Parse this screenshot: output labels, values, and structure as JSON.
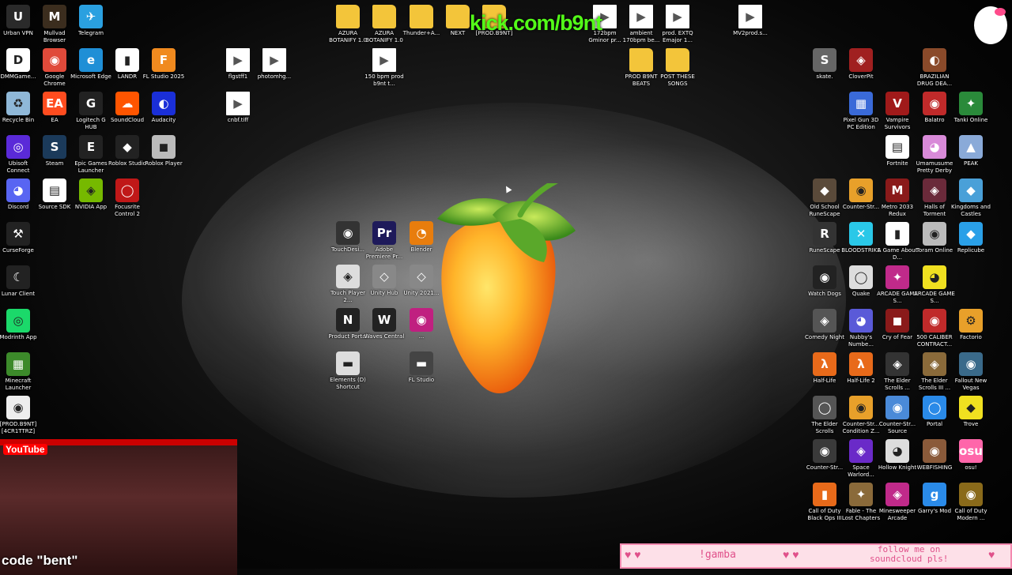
{
  "overlay": {
    "kick": "kick.com/b9nt",
    "code": "code \"bent\"",
    "gamba": "!gamba",
    "follow_line1": "follow me on",
    "follow_line2": "soundcloud pls!",
    "youtube": "YouTube"
  },
  "desktop": {
    "icons_left": [
      {
        "name": "ucloud-vpn-icon",
        "label": "Urban VPN",
        "glyph": "U",
        "color": "#2a2a2a"
      },
      {
        "name": "mullvad-browser-icon",
        "label": "Mullvad Browser",
        "glyph": "M",
        "color": "#3b2d1e"
      },
      {
        "name": "telegram-icon",
        "label": "Telegram",
        "glyph": "✈",
        "color": "#2aa0e0"
      },
      {
        "name": "dmm-icon",
        "label": "DMMGame...",
        "glyph": "D",
        "color": "#fff"
      },
      {
        "name": "google-chrome-icon",
        "label": "Google Chrome",
        "glyph": "◉",
        "color": "#e04a3a"
      },
      {
        "name": "microsoft-edge-icon",
        "label": "Microsoft Edge",
        "glyph": "e",
        "color": "#1f8fd6"
      },
      {
        "name": "landr-icon",
        "label": "LANDR",
        "glyph": "▮",
        "color": "#fff"
      },
      {
        "name": "fl-studio-icon",
        "label": "FL Studio 2025",
        "glyph": "F",
        "color": "#f08a1f"
      },
      {
        "name": "recycle-bin-icon",
        "label": "Recycle Bin",
        "glyph": "♻",
        "color": "#8fb8d8"
      },
      {
        "name": "ea-icon",
        "label": "EA",
        "glyph": "EA",
        "color": "#ff4c1f"
      },
      {
        "name": "logitech-ghub-icon",
        "label": "Logitech G HUB",
        "glyph": "G",
        "color": "#222"
      },
      {
        "name": "soundcloud-icon",
        "label": "SoundCloud",
        "glyph": "☁",
        "color": "#ff5500"
      },
      {
        "name": "audacity-icon",
        "label": "Audacity",
        "glyph": "◐",
        "color": "#1a2fd8"
      },
      {
        "name": "ubisoft-connect-icon",
        "label": "Ubisoft Connect",
        "glyph": "◎",
        "color": "#5a2ad8"
      },
      {
        "name": "steam-icon",
        "label": "Steam",
        "glyph": "S",
        "color": "#1b3a5a"
      },
      {
        "name": "epic-games-icon",
        "label": "Epic Games Launcher",
        "glyph": "E",
        "color": "#222"
      },
      {
        "name": "roblox-studio-icon",
        "label": "Roblox Studio",
        "glyph": "◆",
        "color": "#222"
      },
      {
        "name": "roblox-player-icon",
        "label": "Roblox Player",
        "glyph": "◼",
        "color": "#bbb"
      },
      {
        "name": "discord-icon",
        "label": "Discord",
        "glyph": "◕",
        "color": "#5865f2"
      },
      {
        "name": "source-sdk-icon",
        "label": "Source SDK",
        "glyph": "▤",
        "color": "#fff"
      },
      {
        "name": "nvidia-app-icon",
        "label": "NVIDIA App",
        "glyph": "◈",
        "color": "#76b900"
      },
      {
        "name": "focusrite-icon",
        "label": "Focusrite Control 2",
        "glyph": "◯",
        "color": "#c01818"
      },
      {
        "name": "curseforge-icon",
        "label": "CurseForge",
        "glyph": "⚒",
        "color": "#222"
      },
      {
        "name": "lunar-client-icon",
        "label": "Lunar Client",
        "glyph": "☾",
        "color": "#222"
      },
      {
        "name": "modrinth-icon",
        "label": "Modrinth App",
        "glyph": "◎",
        "color": "#1bd96a"
      },
      {
        "name": "minecraft-launcher-icon",
        "label": "Minecraft Launcher",
        "glyph": "▦",
        "color": "#3c8a2a"
      },
      {
        "name": "prod-b9nt-icon",
        "label": "[PROD.B9NT] [4CR1TTRZ]",
        "glyph": "◉",
        "color": "#eee"
      }
    ],
    "icons_top": [
      {
        "name": "folder-azura-1-icon",
        "label": "AZURA BOTANIFY 1.0",
        "kind": "folder"
      },
      {
        "name": "folder-azura-2-icon",
        "label": "AZURA BOTANIFY 1.0",
        "kind": "folder"
      },
      {
        "name": "folder-thunder-icon",
        "label": "Thunder+A...",
        "kind": "folder"
      },
      {
        "name": "folder-next-icon",
        "label": "NEXT",
        "kind": "folder"
      },
      {
        "name": "folder-prod-icon",
        "label": "[PROD.B9NT]",
        "kind": "folder"
      },
      {
        "name": "audio-172bpm-icon",
        "label": "172bpm Gminor pr...",
        "kind": "doc"
      },
      {
        "name": "audio-ambient-icon",
        "label": "ambient 170bpm be...",
        "kind": "doc"
      },
      {
        "name": "audio-extq-icon",
        "label": "prod. EXTQ Emajor 1...",
        "kind": "doc"
      },
      {
        "name": "audio-mv2-icon",
        "label": "MV2prod.s...",
        "kind": "doc"
      },
      {
        "name": "file-flgstff-icon",
        "label": "flgstff1",
        "kind": "doc"
      },
      {
        "name": "file-photomhg-icon",
        "label": "photomhg...",
        "kind": "doc"
      },
      {
        "name": "audio-150bpm-icon",
        "label": "150 bpm prod b9nt t...",
        "kind": "doc"
      },
      {
        "name": "file-cnbf-icon",
        "label": "cnbf.tiff",
        "kind": "doc"
      },
      {
        "name": "folder-prod-beats-icon",
        "label": "PROD B9NT BEATS",
        "kind": "folder"
      },
      {
        "name": "folder-post-songs-icon",
        "label": "POST THESE SONGS",
        "kind": "folder"
      }
    ],
    "icons_center": [
      {
        "name": "touchdesigner-icon",
        "label": "TouchDesi...",
        "glyph": "◉",
        "color": "#333"
      },
      {
        "name": "adobe-premiere-icon",
        "label": "Adobe Premiere Pr...",
        "glyph": "Pr",
        "color": "#1e1a5a"
      },
      {
        "name": "blender-icon",
        "label": "Blender",
        "glyph": "◔",
        "color": "#e87d0d"
      },
      {
        "name": "touch-player-icon",
        "label": "Touch Player 2...",
        "glyph": "◈",
        "color": "#ddd"
      },
      {
        "name": "unity-hub-icon",
        "label": "Unity Hub",
        "glyph": "◇",
        "color": "#888"
      },
      {
        "name": "unity-icon",
        "label": "Unity 2021...",
        "glyph": "◇",
        "color": "#888"
      },
      {
        "name": "product-portal-icon",
        "label": "Product Portal",
        "glyph": "N",
        "color": "#222"
      },
      {
        "name": "waves-central-icon",
        "label": "Waves Central",
        "glyph": "W",
        "color": "#222"
      },
      {
        "name": "cleaner-icon",
        "label": "...",
        "glyph": "◉",
        "color": "#c02080"
      },
      {
        "name": "elements-shortcut-icon",
        "label": "Elements (D) Shortcut",
        "glyph": "▬",
        "color": "#ddd"
      },
      {
        "name": "fl-studio-2-icon",
        "label": "FL Studio",
        "glyph": "▬",
        "color": "#444"
      }
    ],
    "icons_right": [
      {
        "name": "skate-icon",
        "label": "skate.",
        "glyph": "S",
        "color": "#666"
      },
      {
        "name": "cloverpit-icon",
        "label": "CloverPit",
        "glyph": "◈",
        "color": "#a02020"
      },
      {
        "name": "brazilian-drug-icon",
        "label": "BRAZILIAN DRUG DEA...",
        "glyph": "◐",
        "color": "#8a4a2a"
      },
      {
        "name": "pixel-gun-icon",
        "label": "Pixel Gun 3D PC Edition",
        "glyph": "▦",
        "color": "#3a6ad8"
      },
      {
        "name": "vampire-survivors-icon",
        "label": "Vampire Survivors",
        "glyph": "V",
        "color": "#a01a1a"
      },
      {
        "name": "balatro-icon",
        "label": "Balatro",
        "glyph": "◉",
        "color": "#c02a2a"
      },
      {
        "name": "tanki-online-icon",
        "label": "Tanki Online",
        "glyph": "✦",
        "color": "#2a8a3a"
      },
      {
        "name": "fortnite-icon",
        "label": "Fortnite",
        "glyph": "▤",
        "color": "#fff"
      },
      {
        "name": "umamusume-icon",
        "label": "Umamusume Pretty Derby",
        "glyph": "◕",
        "color": "#d88ad8"
      },
      {
        "name": "peak-icon",
        "label": "PEAK",
        "glyph": "▲",
        "color": "#8aaad8"
      },
      {
        "name": "old-school-runescape-icon",
        "label": "Old School RuneScape",
        "glyph": "◆",
        "color": "#5a4a3a"
      },
      {
        "name": "counter-strike-icon",
        "label": "Counter-Str...",
        "glyph": "◉",
        "color": "#e8a02a"
      },
      {
        "name": "metro-2033-icon",
        "label": "Metro 2033 Redux",
        "glyph": "M",
        "color": "#8a1a1a"
      },
      {
        "name": "halls-of-torment-icon",
        "label": "Halls of Torment",
        "glyph": "◈",
        "color": "#6a2a3a"
      },
      {
        "name": "kingdoms-castles-icon",
        "label": "Kingdoms and Castles",
        "glyph": "◆",
        "color": "#4aa0d8"
      },
      {
        "name": "runescape-icon",
        "label": "RuneScape",
        "glyph": "R",
        "color": "#333"
      },
      {
        "name": "bloodstrike-icon",
        "label": "BLOODSTRIKE",
        "glyph": "✕",
        "color": "#2ac8e8"
      },
      {
        "name": "a-game-about-icon",
        "label": "A Game About D...",
        "glyph": "▮",
        "color": "#fff"
      },
      {
        "name": "toram-online-icon",
        "label": "Toram Online",
        "glyph": "◉",
        "color": "#bbb"
      },
      {
        "name": "replicube-icon",
        "label": "Replicube",
        "glyph": "◆",
        "color": "#2aa0e8"
      },
      {
        "name": "watch-dogs-icon",
        "label": "Watch Dogs",
        "glyph": "◉",
        "color": "#222"
      },
      {
        "name": "quake-icon",
        "label": "Quake",
        "glyph": "◯",
        "color": "#ddd"
      },
      {
        "name": "arcade-game-icon",
        "label": "ARCADE GAME S...",
        "glyph": "✦",
        "color": "#c02a8a"
      },
      {
        "name": "arcade-game-2-icon",
        "label": "ARCADE GAME S...",
        "glyph": "◕",
        "color": "#f0e020"
      },
      {
        "name": "comedy-night-icon",
        "label": "Comedy Night",
        "glyph": "◈",
        "color": "#555"
      },
      {
        "name": "nubbys-number-icon",
        "label": "Nubby's Numbe...",
        "glyph": "◕",
        "color": "#5a5ad8"
      },
      {
        "name": "cry-of-fear-icon",
        "label": "Cry of Fear",
        "glyph": "◼",
        "color": "#8a1a1a"
      },
      {
        "name": "500-caliber-icon",
        "label": "500 CALIBER CONTRACT...",
        "glyph": "◉",
        "color": "#c02a2a"
      },
      {
        "name": "factorio-icon",
        "label": "Factorio",
        "glyph": "⚙",
        "color": "#e8a02a"
      },
      {
        "name": "half-life-icon",
        "label": "Half-Life",
        "glyph": "λ",
        "color": "#e86a1a"
      },
      {
        "name": "half-life-2-icon",
        "label": "Half-Life 2",
        "glyph": "λ",
        "color": "#e86a1a"
      },
      {
        "name": "elder-scrolls-icon",
        "label": "The Elder Scrolls ...",
        "glyph": "◈",
        "color": "#333"
      },
      {
        "name": "elder-scrolls-2-icon",
        "label": "The Elder Scrolls III ...",
        "glyph": "◈",
        "color": "#8a6a3a"
      },
      {
        "name": "fallout-new-vegas-icon",
        "label": "Fallout New Vegas",
        "glyph": "◉",
        "color": "#3a6a8a"
      },
      {
        "name": "elder-scrolls-3-icon",
        "label": "The Elder Scrolls",
        "glyph": "◯",
        "color": "#555"
      },
      {
        "name": "counter-strike-cz-icon",
        "label": "Counter-Str... Condition Z...",
        "glyph": "◉",
        "color": "#e8a02a"
      },
      {
        "name": "counter-strike-source-icon",
        "label": "Counter-Str... Source",
        "glyph": "◉",
        "color": "#4a8ad8"
      },
      {
        "name": "portal-icon",
        "label": "Portal",
        "glyph": "◯",
        "color": "#2a8ae8"
      },
      {
        "name": "trove-icon",
        "label": "Trove",
        "glyph": "◆",
        "color": "#f0e020"
      },
      {
        "name": "counter-strike-2-icon",
        "label": "Counter-Str...",
        "glyph": "◉",
        "color": "#3a3a3a"
      },
      {
        "name": "space-warlord-icon",
        "label": "Space Warlord...",
        "glyph": "◈",
        "color": "#6a2ac8"
      },
      {
        "name": "hollow-knight-icon",
        "label": "Hollow Knight",
        "glyph": "◕",
        "color": "#ddd"
      },
      {
        "name": "webfishing-icon",
        "label": "WEBFISHING",
        "glyph": "◉",
        "color": "#8a5a3a"
      },
      {
        "name": "osu-icon",
        "label": "osu!",
        "glyph": "osu",
        "color": "#ff66aa"
      },
      {
        "name": "call-of-duty-bo3-icon",
        "label": "Call of Duty Black Ops III",
        "glyph": "▮",
        "color": "#e86a1a"
      },
      {
        "name": "fable-icon",
        "label": "Fable - The Lost Chapters",
        "glyph": "✦",
        "color": "#8a6a3a"
      },
      {
        "name": "minesweeper-icon",
        "label": "Minesweeper Arcade",
        "glyph": "◈",
        "color": "#c02a8a"
      },
      {
        "name": "garrys-mod-icon",
        "label": "Garry's Mod",
        "glyph": "g",
        "color": "#2a8ae8"
      },
      {
        "name": "call-of-duty-mw-icon",
        "label": "Call of Duty Modern ...",
        "glyph": "◉",
        "color": "#8a6a1a"
      }
    ]
  }
}
